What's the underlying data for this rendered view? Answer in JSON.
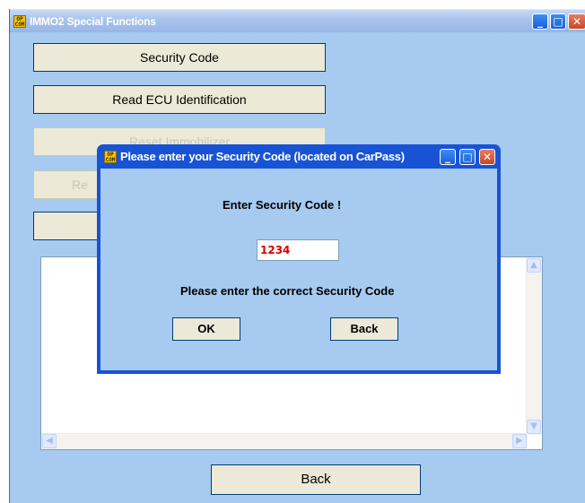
{
  "main_window": {
    "title": "IMMO2 Special Functions",
    "app_icon_text": "OP COM",
    "controls": {
      "minimize": "_",
      "maximize": "□",
      "close": "✕"
    },
    "buttons": {
      "security_code": "Security Code",
      "read_ecu_identification": "Read ECU Identification",
      "reset_immobilizer": "Reset Immobilizer",
      "hidden_button_1": "Re",
      "back": "Back"
    }
  },
  "dialog": {
    "title": "Please enter your Security Code (located on CarPass)",
    "prompt": "Enter Security Code !",
    "input_value": "1234",
    "message": "Please enter the correct Security Code",
    "ok_label": "OK",
    "back_label": "Back"
  },
  "colors": {
    "window_bg": "#a6caf0",
    "dialog_frame": "#1853d6",
    "input_text": "#d40000"
  }
}
